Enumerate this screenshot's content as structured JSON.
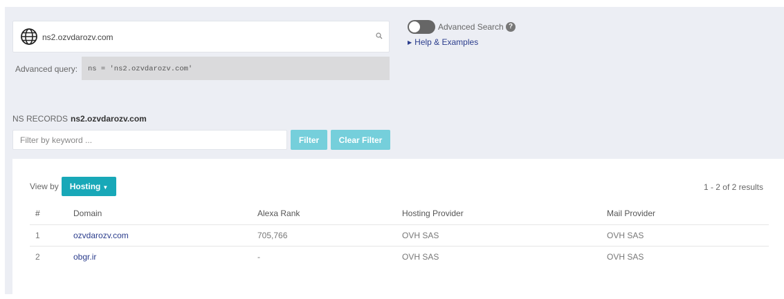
{
  "search": {
    "value": "ns2.ozvdarozv.com",
    "advanced_query_label": "Advanced query:",
    "advanced_query_code": "ns = 'ns2.ozvdarozv.com'"
  },
  "advanced": {
    "toggle_label": "Advanced Search",
    "toggle_on": false,
    "help_mark": "?",
    "help_link": "Help & Examples"
  },
  "records": {
    "type_label": "NS RECORDS",
    "domain": "ns2.ozvdarozv.com"
  },
  "filter": {
    "placeholder": "Filter by keyword ...",
    "filter_button": "Filter",
    "clear_button": "Clear Filter"
  },
  "results": {
    "view_by_label": "View by",
    "view_by_value": "Hosting",
    "count": "1 - 2 of 2 results",
    "columns": [
      "#",
      "Domain",
      "Alexa Rank",
      "Hosting Provider",
      "Mail Provider"
    ],
    "rows": [
      {
        "num": "1",
        "domain": "ozvdarozv.com",
        "alexa": "705,766",
        "hosting": "OVH SAS",
        "mail": "OVH SAS"
      },
      {
        "num": "2",
        "domain": "obgr.ir",
        "alexa": "-",
        "hosting": "OVH SAS",
        "mail": "OVH SAS"
      }
    ]
  },
  "icons": [
    "globe-icon",
    "search-icon",
    "help-icon",
    "caret-right-icon",
    "caret-down-icon"
  ],
  "colors": {
    "accent": "#18a8b8",
    "accent_light": "#75cfdb",
    "link": "#2a3c8c",
    "background": "#eceef4"
  }
}
